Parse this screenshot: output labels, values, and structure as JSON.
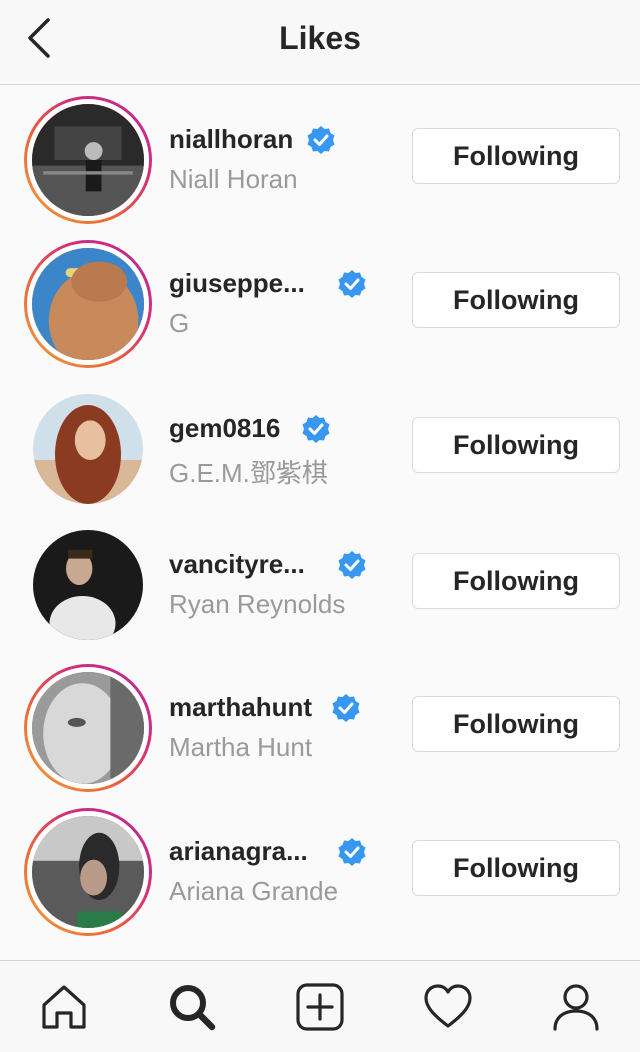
{
  "header": {
    "title": "Likes",
    "back_icon": "chevron-left-icon"
  },
  "rows": [
    {
      "username": "niallhoran",
      "fullname": "Niall Horan",
      "button": "Following",
      "story_ring": true,
      "verified": true
    },
    {
      "username": "giuseppe...",
      "fullname": "G",
      "button": "Following",
      "story_ring": true,
      "verified": true
    },
    {
      "username": "gem0816",
      "fullname": "G.E.M.鄧紫棋",
      "button": "Following",
      "story_ring": false,
      "verified": true
    },
    {
      "username": "vancityre...",
      "fullname": "Ryan Reynolds",
      "button": "Following",
      "story_ring": false,
      "verified": true
    },
    {
      "username": "marthahunt",
      "fullname": "Martha Hunt",
      "button": "Following",
      "story_ring": true,
      "verified": true
    },
    {
      "username": "arianagra...",
      "fullname": "Ariana Grande",
      "button": "Following",
      "story_ring": true,
      "verified": true
    }
  ],
  "tabbar": {
    "items": [
      {
        "name": "home-icon"
      },
      {
        "name": "search-icon"
      },
      {
        "name": "add-post-icon"
      },
      {
        "name": "heart-icon"
      },
      {
        "name": "profile-icon"
      }
    ]
  },
  "colors": {
    "verified": "#3897f0",
    "story_ring_start": "#f2a53b",
    "story_ring_end": "#b52a9c",
    "secondary_text": "#9a9a9a"
  }
}
